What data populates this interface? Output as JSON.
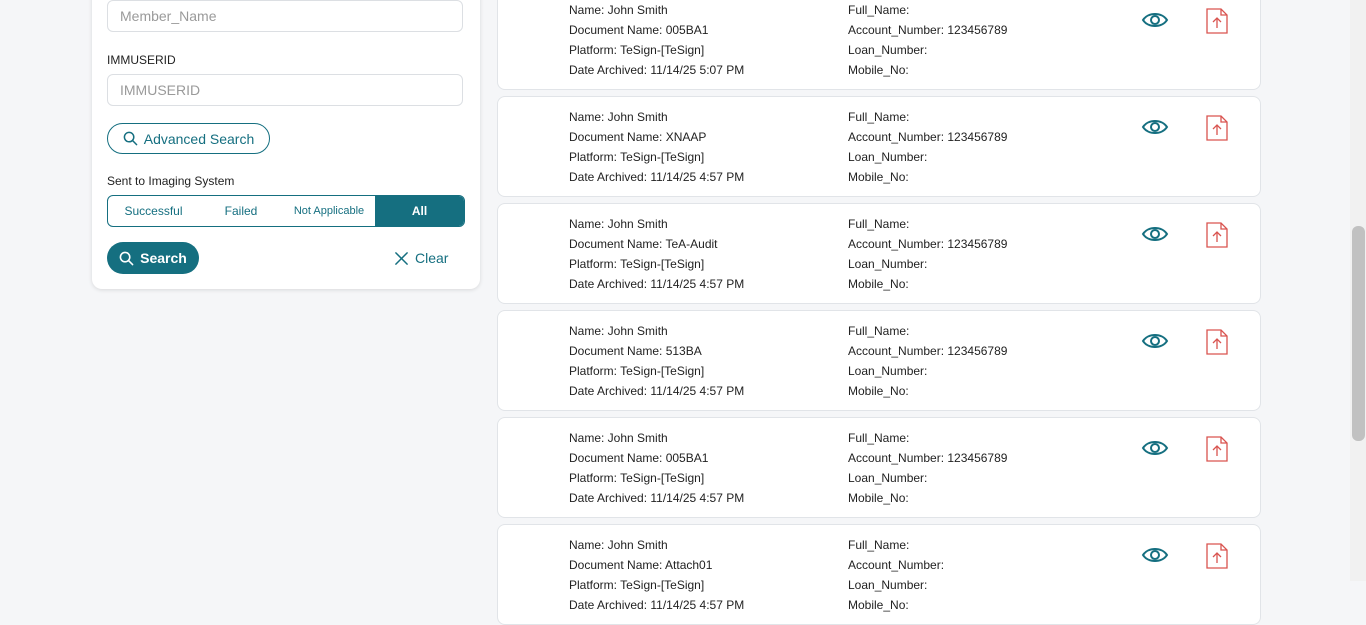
{
  "filters": {
    "member_name": {
      "value": "",
      "placeholder": "Member_Name"
    },
    "immuserid": {
      "label": "IMMUSERID",
      "value": "",
      "placeholder": "IMMUSERID"
    },
    "advanced_search_label": "Advanced Search",
    "sent_to_imaging": {
      "label": "Sent to Imaging System",
      "options": [
        "Successful",
        "Failed",
        "Not Applicable",
        "All"
      ],
      "selected": "All"
    },
    "search_label": "Search",
    "clear_label": "Clear"
  },
  "results": [
    {
      "name": "Name: John Smith",
      "document": "Document Name: 005BA1",
      "platform": "Platform: TeSign-[TeSign]",
      "date": "Date Archived: 11/14/25 5:07 PM",
      "full_name": "Full_Name:",
      "account": "Account_Number: 123456789",
      "loan": "Loan_Number:",
      "mobile": "Mobile_No:"
    },
    {
      "name": "Name: John Smith",
      "document": "Document Name: XNAAP",
      "platform": "Platform: TeSign-[TeSign]",
      "date": "Date Archived: 11/14/25 4:57 PM",
      "full_name": "Full_Name:",
      "account": "Account_Number: 123456789",
      "loan": "Loan_Number:",
      "mobile": "Mobile_No:"
    },
    {
      "name": "Name: John Smith",
      "document": "Document Name: TeA-Audit",
      "platform": "Platform: TeSign-[TeSign]",
      "date": "Date Archived: 11/14/25 4:57 PM",
      "full_name": "Full_Name:",
      "account": "Account_Number: 123456789",
      "loan": "Loan_Number:",
      "mobile": "Mobile_No:"
    },
    {
      "name": "Name: John Smith",
      "document": "Document Name: 513BA",
      "platform": "Platform: TeSign-[TeSign]",
      "date": "Date Archived: 11/14/25 4:57 PM",
      "full_name": "Full_Name:",
      "account": "Account_Number: 123456789",
      "loan": "Loan_Number:",
      "mobile": "Mobile_No:"
    },
    {
      "name": "Name: John Smith",
      "document": "Document Name: 005BA1",
      "platform": "Platform: TeSign-[TeSign]",
      "date": "Date Archived: 11/14/25 4:57 PM",
      "full_name": "Full_Name:",
      "account": "Account_Number: 123456789",
      "loan": "Loan_Number:",
      "mobile": "Mobile_No:"
    },
    {
      "name": "Name: John Smith",
      "document": "Document Name: Attach01",
      "platform": "Platform: TeSign-[TeSign]",
      "date": "Date Archived: 11/14/25 4:57 PM",
      "full_name": "Full_Name:",
      "account": "Account_Number:",
      "loan": "Loan_Number:",
      "mobile": "Mobile_No:"
    }
  ],
  "icons": {
    "view": "eye-icon",
    "pdf": "pdf-upload-icon",
    "search": "search-icon",
    "clear": "close-icon"
  },
  "colors": {
    "accent": "#156f80",
    "pdf": "#d9534f"
  }
}
